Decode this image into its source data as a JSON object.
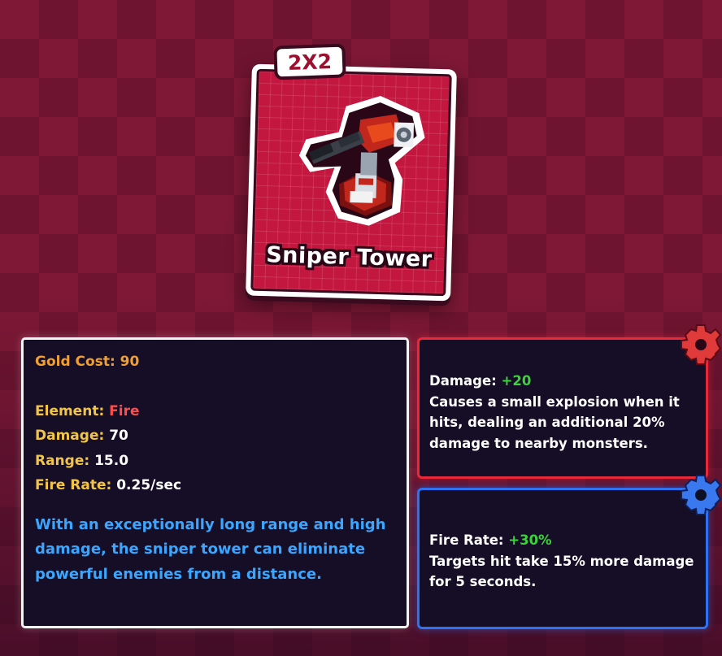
{
  "card": {
    "size_badge": "2X2",
    "title": "Sniper Tower",
    "art_icon": "sniper-tower-icon"
  },
  "stats": {
    "gold_cost": {
      "label": "Gold Cost:",
      "value": "90"
    },
    "element": {
      "label": "Element:",
      "value": "Fire"
    },
    "damage": {
      "label": "Damage:",
      "value": "70"
    },
    "range": {
      "label": "Range:",
      "value": "15.0"
    },
    "fire_rate": {
      "label": "Fire Rate:",
      "value": "0.25/sec"
    },
    "description": "With an exceptionally long range and high damage, the sniper tower can eliminate powerful enemies from a distance."
  },
  "upgrades": [
    {
      "label": "Damage:",
      "bonus": "+20",
      "description": "Causes a small explosion when it hits, dealing an additional 20% damage to nearby monsters.",
      "color": "#e62a3a",
      "icon": "gear-icon"
    },
    {
      "label": "Fire Rate:",
      "bonus": "+30%",
      "description": "Targets hit take 15% more damage for 5 seconds.",
      "color": "#2d72f0",
      "icon": "gear-icon"
    }
  ],
  "colors": {
    "gold": "#f0a030",
    "stat_label": "#f3c542",
    "fire": "#ff4d4d",
    "description": "#3aa6ff",
    "bonus": "#3cd23c",
    "card": "#c4173f"
  }
}
